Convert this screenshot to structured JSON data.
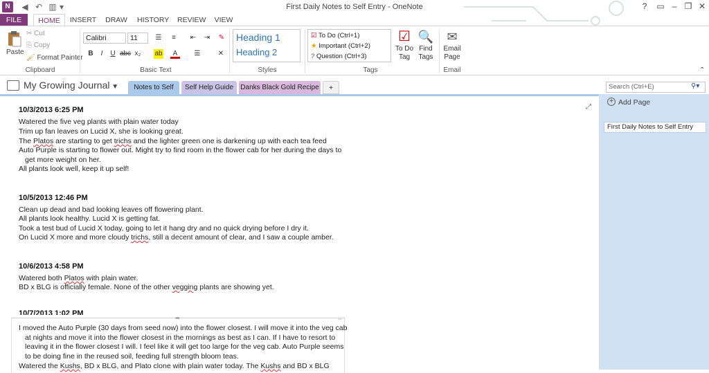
{
  "window": {
    "title": "First Daily Notes to Self Entry - OneNote",
    "app_logo": "N",
    "help": "?",
    "minimize": "–",
    "restore": "❐",
    "close": "✕",
    "options": "▭"
  },
  "ribbon_tabs": [
    "FILE",
    "HOME",
    "INSERT",
    "DRAW",
    "HISTORY",
    "REVIEW",
    "VIEW"
  ],
  "clipboard": {
    "paste": "Paste",
    "cut": "Cut",
    "copy": "Copy",
    "format_painter": "Format Painter",
    "group_label": "Clipboard"
  },
  "basic_text": {
    "font": "Calibri",
    "size": "11",
    "bold": "B",
    "italic": "I",
    "underline": "U",
    "strike": "abc",
    "subscript": "x₂",
    "group_label": "Basic Text"
  },
  "styles": {
    "heading1": "Heading 1",
    "heading2": "Heading 2",
    "group_label": "Styles"
  },
  "tags": {
    "items": [
      "To Do (Ctrl+1)",
      "Important (Ctrl+2)",
      "Question (Ctrl+3)"
    ],
    "group_label": "Tags",
    "todo_tag": "To Do Tag",
    "find_tags": "Find Tags"
  },
  "email": {
    "label": "Email Page",
    "group_label": "Email"
  },
  "notebook": {
    "title": "My Growing Journal",
    "sections": [
      "Notes to Self",
      "Self Help Guide",
      "Danks Black Gold Recipe",
      "+"
    ],
    "search_placeholder": "Search (Ctrl+E)"
  },
  "panel": {
    "add_page": "Add Page",
    "pages": [
      "First Daily Notes to Self Entry"
    ]
  },
  "entries": [
    {
      "date": "10/3/2013 6:25 PM",
      "lines": [
        "Watered the five veg plants with plain water today",
        "Trim up fan leaves on Lucid X, she is looking great.",
        "The Platos are starting to get trichs and the lighter green one is darkening up with each tea feed",
        "Auto Purple is starting to flower out.  Might try to find room in the flower cab for her during the days to",
        "get more weight on her.",
        "All plants look well, keep it up self!"
      ]
    },
    {
      "date": "10/5/2013 12:46 PM",
      "lines": [
        "Clean up dead and bad looking leaves off flowering plant.",
        "All plants look healthy.  Lucid X is getting fat.",
        "Took a test bud of Lucid X today, going to let it hang dry and no quick drying before I dry it.",
        "On Lucid X more and more cloudy trichs, still a decent amount of clear, and I saw a couple amber."
      ]
    },
    {
      "date": "10/6/2013 4:58 PM",
      "lines": [
        "Watered both Platos with plain water.",
        "BD x BLG is officially female.  None of the other vegging plants are showing yet."
      ]
    },
    {
      "date": "10/7/2013 1:02 PM",
      "lines": [
        "I moved the Auto Purple (30 days from seed now) into the flower closest.  I will move it into the veg cab",
        "at nights and move it into the flower closest in the mornings as best as I can.  If I have to resort to",
        "leaving it in the flower closest I will.  I feel like it will get too large for the veg cab.  Auto Purple seems",
        "to be doing fine in the reused soil, feeding full strength bloom teas.",
        "Watered the Kushs, BD x BLG, and Plato clone with plain water today.  The Kushs and BD x BLG"
      ]
    }
  ],
  "colors": {
    "brand": "#80397b",
    "panel": "#cfe1f3",
    "section_blue": "#a9c8ea",
    "section_lavender": "#c9c3e6",
    "section_pink": "#d8b8dc"
  }
}
